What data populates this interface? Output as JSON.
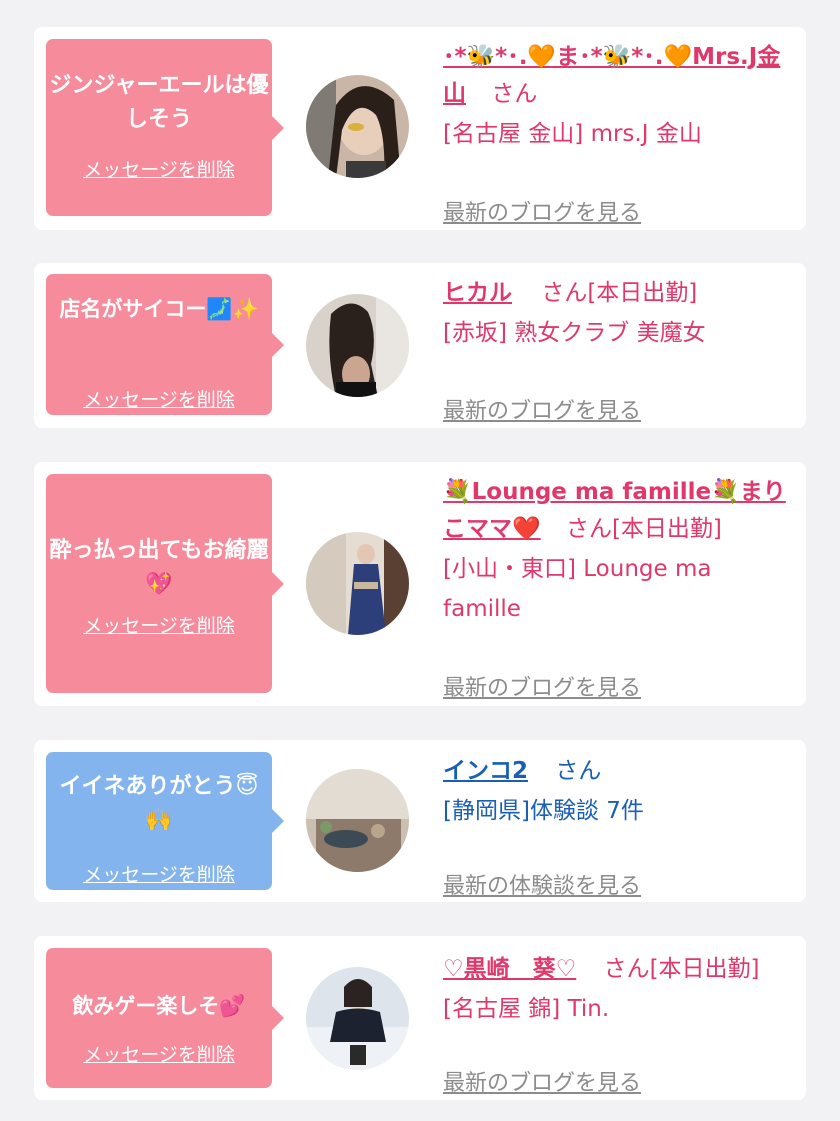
{
  "cards": [
    {
      "bubble_color": "#f68b9c",
      "message": "ジンジャーエールは優しそう",
      "delete_label": "メッセージを削除",
      "name": "･*🐝*･.🧡ま･*🐝*･.🧡Mrs.J金山",
      "san": "さん",
      "status": "",
      "shop": "[名古屋 金山] mrs.J 金山",
      "link": "最新のブログを見る"
    },
    {
      "bubble_color": "#f68b9c",
      "message": "店名がサイコー🗾✨",
      "delete_label": "メッセージを削除",
      "name": "ヒカル",
      "san": "さん",
      "status": "[本日出勤]",
      "shop": "[赤坂] 熟女クラブ 美魔女",
      "link": "最新のブログを見る"
    },
    {
      "bubble_color": "#f68b9c",
      "message": "酔っ払っ出てもお綺麗💖",
      "delete_label": "メッセージを削除",
      "name": "💐Lounge ma famille💐まりこママ❤️",
      "san": "さん",
      "status": "[本日出勤]",
      "shop": "[小山・東口] Lounge ma famille",
      "link": "最新のブログを見る"
    },
    {
      "bubble_color": "#84b4ee",
      "message": "イイネありがとう😇🙌",
      "delete_label": "メッセージを削除",
      "name": "インコ2",
      "san": "さん",
      "status": "",
      "shop": "[静岡県]体験談 7件",
      "link": "最新の体験談を見る"
    },
    {
      "bubble_color": "#f68b9c",
      "message": "飲みゲー楽しそ💕",
      "delete_label": "メッセージを削除",
      "name": "♡黒崎　葵♡",
      "san": "さん",
      "status": "[本日出勤]",
      "shop": "[名古屋 錦] Tin.",
      "link": "最新のブログを見る"
    }
  ]
}
